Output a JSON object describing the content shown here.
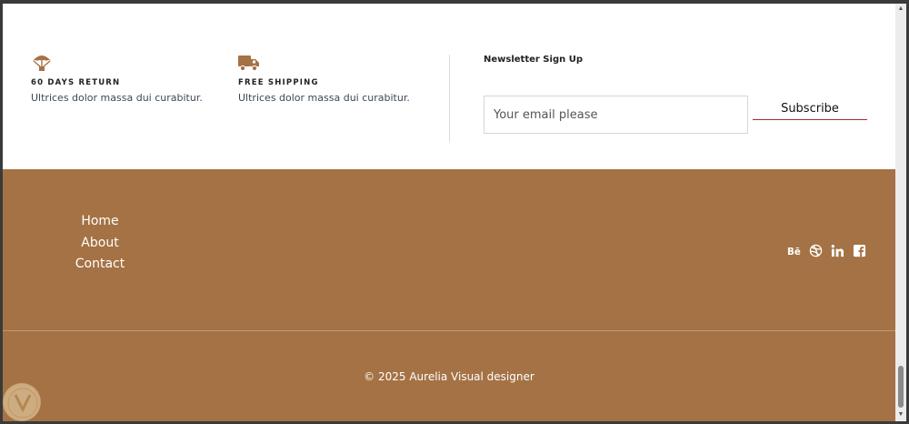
{
  "features": [
    {
      "icon": "parachute-icon",
      "title": "60 DAYS RETURN",
      "desc": "Ultrices dolor massa dui curabitur."
    },
    {
      "icon": "truck-icon",
      "title": "FREE SHIPPING",
      "desc": "Ultrices dolor massa dui curabitur."
    }
  ],
  "newsletter": {
    "title": "Newsletter Sign Up",
    "placeholder": "Your email please",
    "button_label": "Subscribe"
  },
  "footer": {
    "nav": [
      {
        "label": "Home"
      },
      {
        "label": "About"
      },
      {
        "label": "Contact"
      }
    ],
    "social": [
      "behance-icon",
      "dribbble-icon",
      "linkedin-icon",
      "facebook-icon"
    ],
    "copyright": "© 2025 Aurelia Visual designer"
  },
  "colors": {
    "accent": "#a47244",
    "underline": "#a52a2a"
  }
}
